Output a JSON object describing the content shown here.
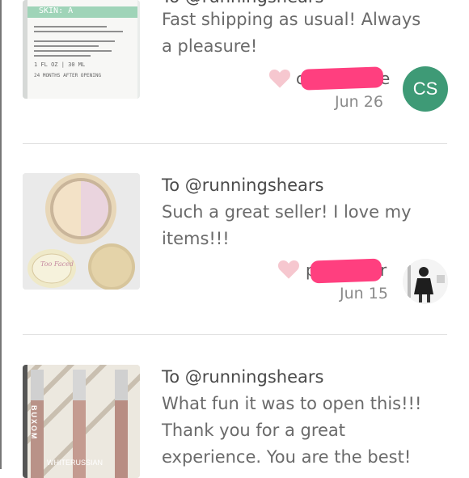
{
  "reviews": [
    {
      "to": "To @runningshears",
      "body_lines": [
        "Fast shipping as usual! Always",
        "a pleasure!"
      ],
      "reviewer": "c",
      "reviewer_end": "e",
      "date": "Jun 26",
      "avatar_initials": "CS",
      "avatar_color": "#3e9a76",
      "thumb_text": [
        "SKIN: A",
        "1 FL OZ | 30 ML",
        "24 MONTHS AFTER OPENING"
      ]
    },
    {
      "to": "To @runningshears",
      "body_lines": [
        "Such a great seller! I love my",
        "items!!!"
      ],
      "reviewer": "p",
      "reviewer_end": "r",
      "date": "Jun 15",
      "thumb_text": [
        "Too Faced"
      ]
    },
    {
      "to": "To @runningshears",
      "body_lines": [
        "What fun it was to open this!!!",
        "Thank you for a great",
        "experience. You are the best!"
      ],
      "thumb_text": [
        "BUXOM",
        "WHITERUSSIAN"
      ]
    }
  ],
  "colors": {
    "redaction": "#ff3f7f",
    "heart": "#f6c7cf",
    "accent": "#3e9a76"
  }
}
